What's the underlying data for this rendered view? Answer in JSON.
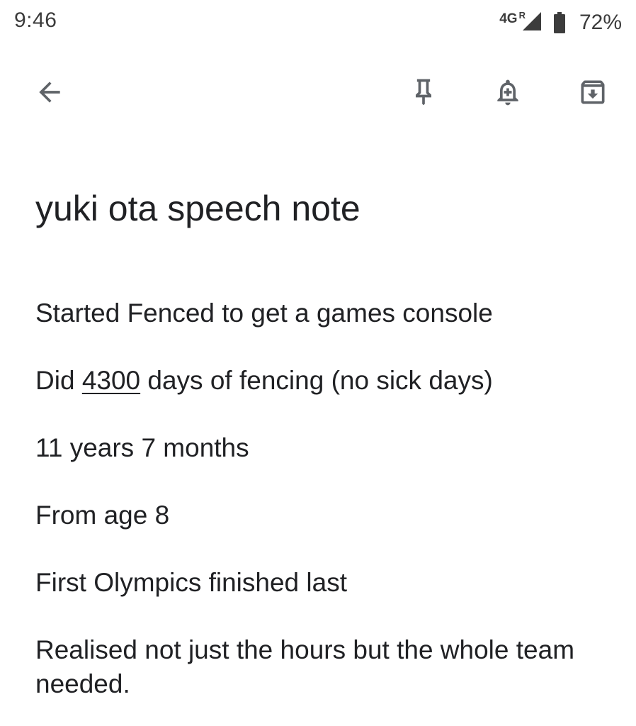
{
  "status_bar": {
    "time": "9:46",
    "network": "4G",
    "roaming": "R",
    "battery_percent": "72%",
    "icons": [
      "signal-icon",
      "battery-icon"
    ]
  },
  "toolbar": {
    "icons": [
      "back-arrow-icon",
      "pin-icon",
      "add-reminder-icon",
      "archive-icon"
    ],
    "icon_color": "#5f6368"
  },
  "note": {
    "title": "yuki ota speech note",
    "paragraphs": [
      {
        "text": "Started Fenced to get a games console"
      },
      {
        "prefix": "Did ",
        "number": "4300",
        "suffix": " days of fencing (no sick days)"
      },
      {
        "text": "11 years 7 months"
      },
      {
        "text": "From age 8"
      },
      {
        "text": "First Olympics finished last"
      },
      {
        "text": "Realised not just the hours but the whole team needed."
      }
    ]
  },
  "colors": {
    "background": "#ffffff",
    "text": "#202124",
    "icon": "#5f6368"
  }
}
